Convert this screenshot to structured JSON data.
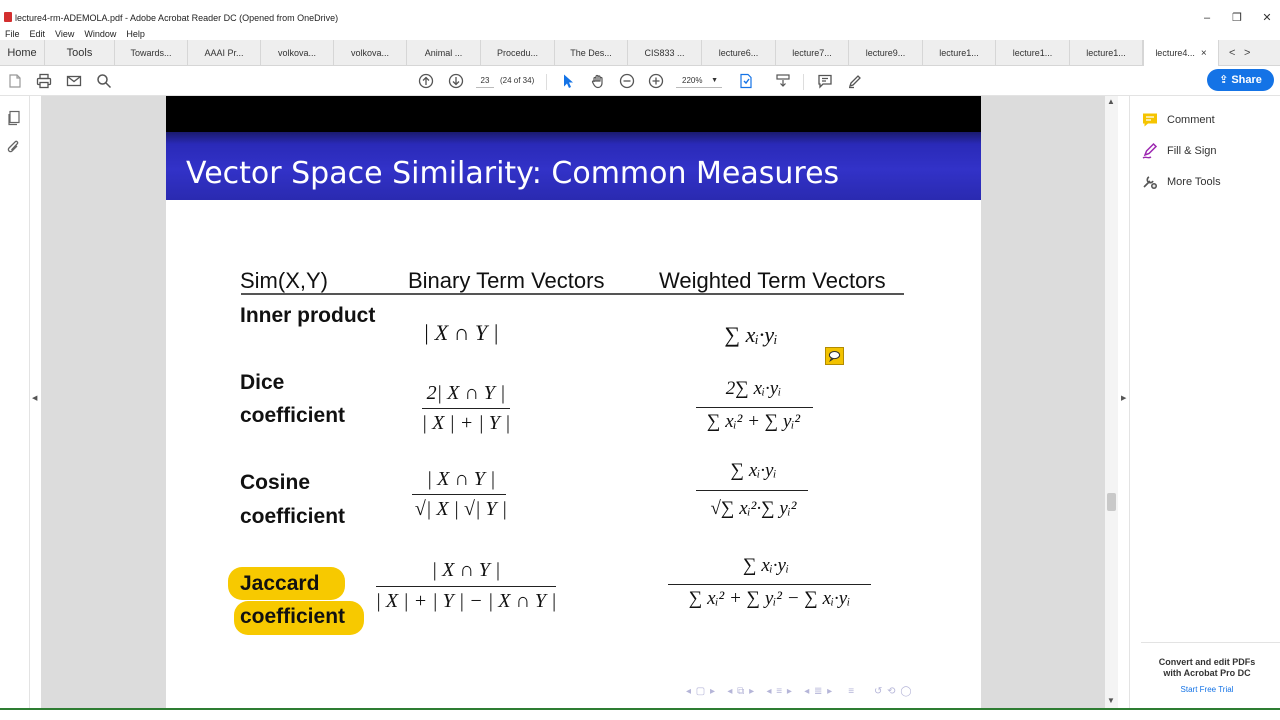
{
  "window": {
    "title": "lecture4-rm-ADEMOLA.pdf - Adobe Acrobat Reader DC (Opened from OneDrive)",
    "controls": [
      "–",
      "❐",
      "✕"
    ]
  },
  "menu": [
    "File",
    "Edit",
    "View",
    "Window",
    "Help"
  ],
  "tabs": {
    "home": "Home",
    "tools": "Tools",
    "docs": [
      "Towards...",
      "AAAI Pr...",
      "volkova...",
      "volkova...",
      "Animal ...",
      "Procedu...",
      "The Des...",
      "CIS833 ...",
      "lecture6...",
      "lecture7...",
      "lecture9...",
      "lecture1...",
      "lecture1...",
      "lecture1..."
    ],
    "active": "lecture4...",
    "close": "×",
    "prev": "<",
    "next": ">"
  },
  "toolbar": {
    "page_current": "23",
    "page_of": "(24 of 34)",
    "zoom": "220%",
    "share_label": "Share"
  },
  "right_panel": {
    "items": [
      "Comment",
      "Fill & Sign",
      "More Tools"
    ],
    "promo_line1": "Convert and edit PDFs",
    "promo_line2": "with Acrobat Pro DC",
    "trial": "Start Free Trial"
  },
  "slide": {
    "title": "Vector Space Similarity:  Common Measures",
    "col_sim": "Sim(X,Y)",
    "col_binary": "Binary Term Vectors",
    "col_weighted": "Weighted Term Vectors",
    "rows": [
      {
        "label1": "Inner product",
        "label2": "",
        "binary": "| X ∩ Y |",
        "weighted": "∑ xᵢ·yᵢ"
      },
      {
        "label1": "Dice",
        "label2": "coefficient",
        "binary_num": "2| X ∩ Y |",
        "binary_den": "| X | + | Y |",
        "weighted_num": "2∑ xᵢ·yᵢ",
        "weighted_den": "∑ xᵢ² + ∑ yᵢ²"
      },
      {
        "label1": "Cosine",
        "label2": "coefficient",
        "binary_num": "| X ∩ Y |",
        "binary_den": "√| X | √| Y |",
        "weighted_num": "∑ xᵢ·yᵢ",
        "weighted_den": "√∑ xᵢ²·∑ yᵢ²"
      },
      {
        "label1": "Jaccard",
        "label2": "coefficient",
        "binary_num": "| X ∩ Y |",
        "binary_den": "| X | + | Y | − | X ∩ Y |",
        "weighted_num": "∑ xᵢ·yᵢ",
        "weighted_den": "∑ xᵢ² + ∑ yᵢ² − ∑ xᵢ·yᵢ"
      }
    ],
    "highlight_color": "#f7c900",
    "title_band_color": "#3232c8"
  }
}
